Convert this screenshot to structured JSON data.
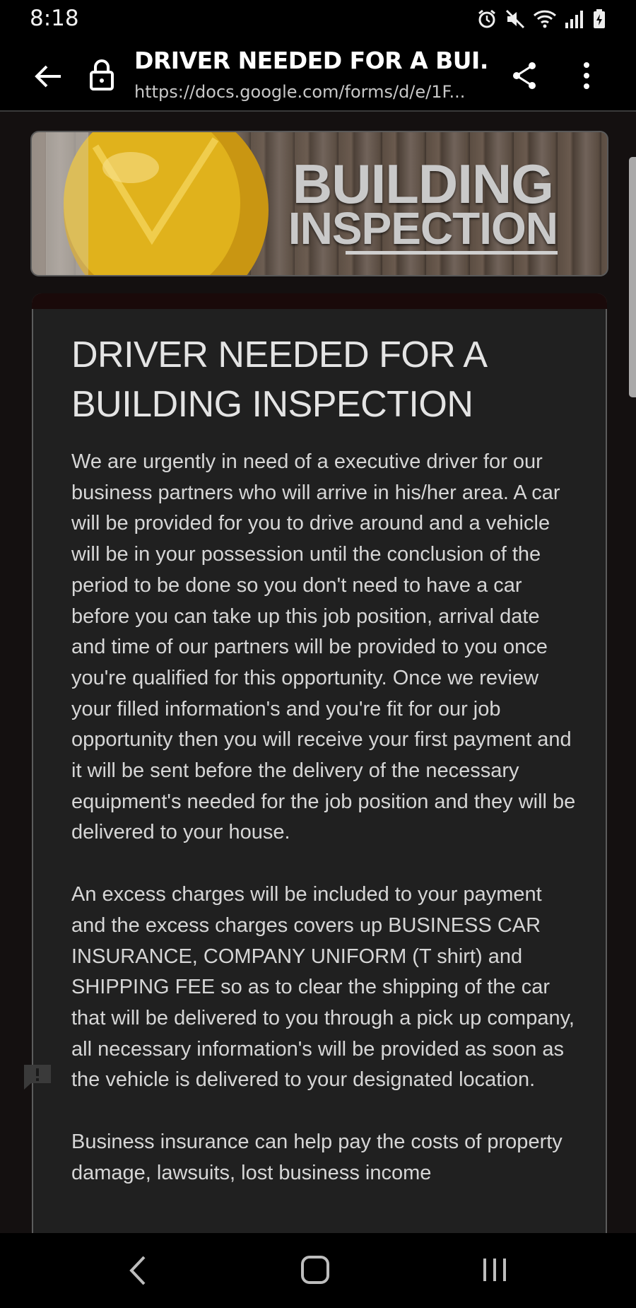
{
  "status_bar": {
    "time": "8:18"
  },
  "toolbar": {
    "title": "DRIVER NEEDED FOR A BUI...",
    "url": "https://docs.google.com/forms/d/e/1F..."
  },
  "banner": {
    "line1": "BUILDING",
    "line2": "INSPECTION"
  },
  "form": {
    "title": "DRIVER NEEDED FOR A BUILDING INSPECTION",
    "paragraphs": [
      "We are urgently in need of a executive driver for our business partners who will arrive in his/her area. A car will be provided for you to drive around and a vehicle will be in your possession until the conclusion of the period to be done so you don't need to have a car before you can take up this job position, arrival date and time of our partners will be provided to you once you're qualified for this opportunity. Once we review your filled information's and you're fit for our job opportunity then you will receive your first payment and it will be sent before the delivery of the necessary equipment's needed for the job position and they will be delivered to your house.",
      "An excess charges will be included to your payment and the excess charges covers up BUSINESS CAR INSURANCE, COMPANY UNIFORM (T shirt) and SHIPPING FEE so as to clear the shipping of the car that will be delivered to you through a pick up company, all necessary information's will be provided as soon as the vehicle is delivered to your designated location.",
      "Business insurance can help pay the costs of property damage, lawsuits, lost business income"
    ]
  },
  "icons": {
    "back": "arrow-left-icon",
    "lock": "lock-icon",
    "share": "share-icon",
    "more": "more-vert-icon",
    "feedback": "feedback-icon",
    "alarm": "alarm-icon",
    "mute": "mute-icon",
    "wifi": "wifi-icon",
    "signal": "signal-icon",
    "battery": "battery-icon"
  },
  "colors": {
    "background": "#141010",
    "card": "#202020",
    "helmet": "#e0b21c"
  }
}
